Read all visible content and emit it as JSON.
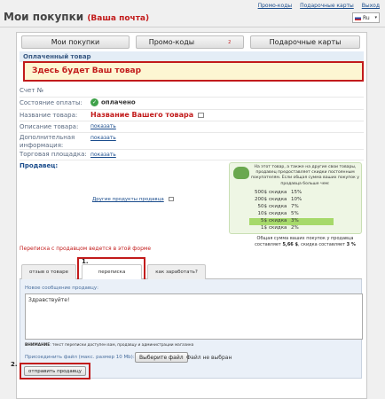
{
  "top_links": [
    "Промо-коды",
    "Подарочные карты",
    "Выход"
  ],
  "page_title": "Мои покупки",
  "page_subtitle": "(Ваша почта)",
  "language": "Ru",
  "main_tabs": [
    {
      "label": "Мои покупки"
    },
    {
      "label": "Промо-коды",
      "count": "2"
    },
    {
      "label": "Подарочные карты"
    }
  ],
  "paid_header": "Оплаченный товар",
  "banner": "Здесь будет Ваш товар",
  "fields": {
    "invoice_label": "Счет №",
    "payment_status_label": "Состояние оплаты:",
    "payment_status_value": "оплачено",
    "product_name_label": "Название товара:",
    "product_name_value": "Название Вашего товара",
    "product_desc_label": "Описание товара:",
    "show_link": "показать",
    "extra_info_label": "Дополнительная информация:",
    "marketplace_label": "Торговая площадка:",
    "seller_label": "Продавец:",
    "other_products_link": "Другие продукты продавца"
  },
  "discount_box": {
    "text": "На этот товар, а также на другие свои товары, продавец предоставляет скидки постоянным покупателям. Если общая сумма ваших покупок у продавца больше чем:",
    "rows": [
      {
        "amount": "500$",
        "word": "скидка",
        "pct": "15%",
        "highlight": false
      },
      {
        "amount": "200$",
        "word": "скидка",
        "pct": "10%",
        "highlight": false
      },
      {
        "amount": "50$",
        "word": "скидка",
        "pct": "7%",
        "highlight": false
      },
      {
        "amount": "10$",
        "word": "скидка",
        "pct": "5%",
        "highlight": false
      },
      {
        "amount": "5$",
        "word": "скидка",
        "pct": "3%",
        "highlight": true
      },
      {
        "amount": "1$",
        "word": "скидка",
        "pct": "2%",
        "highlight": false
      }
    ],
    "total_line1": "Общая сумма ваших покупок у продавца",
    "total_line2_prefix": "составляет",
    "total_amount": "5,66 $",
    "total_line2_mid": ", скидка составляет",
    "total_discount": "3 %"
  },
  "correspondence_note": "Переписка с продавцом ведется в этой форме",
  "lower_tabs": [
    {
      "label": "отзыв о товаре"
    },
    {
      "label": "переписка",
      "marker": "1."
    },
    {
      "label": "как заработать?"
    }
  ],
  "composer": {
    "new_message_label": "Новое сообщение продавцу:",
    "message_text": "Здравствуйте!",
    "note_bold": "ВНИМАНИЕ",
    "note_text": ": текст переписки доступен вам, продавцу и администрации магазина",
    "attach_label": "Присоединить файл (макс. размер 10 Mb):",
    "choose_file_button": "Выберите файл",
    "no_file_text": "Файл не выбран",
    "send_marker": "2.",
    "send_button": "отправить продавцу"
  }
}
